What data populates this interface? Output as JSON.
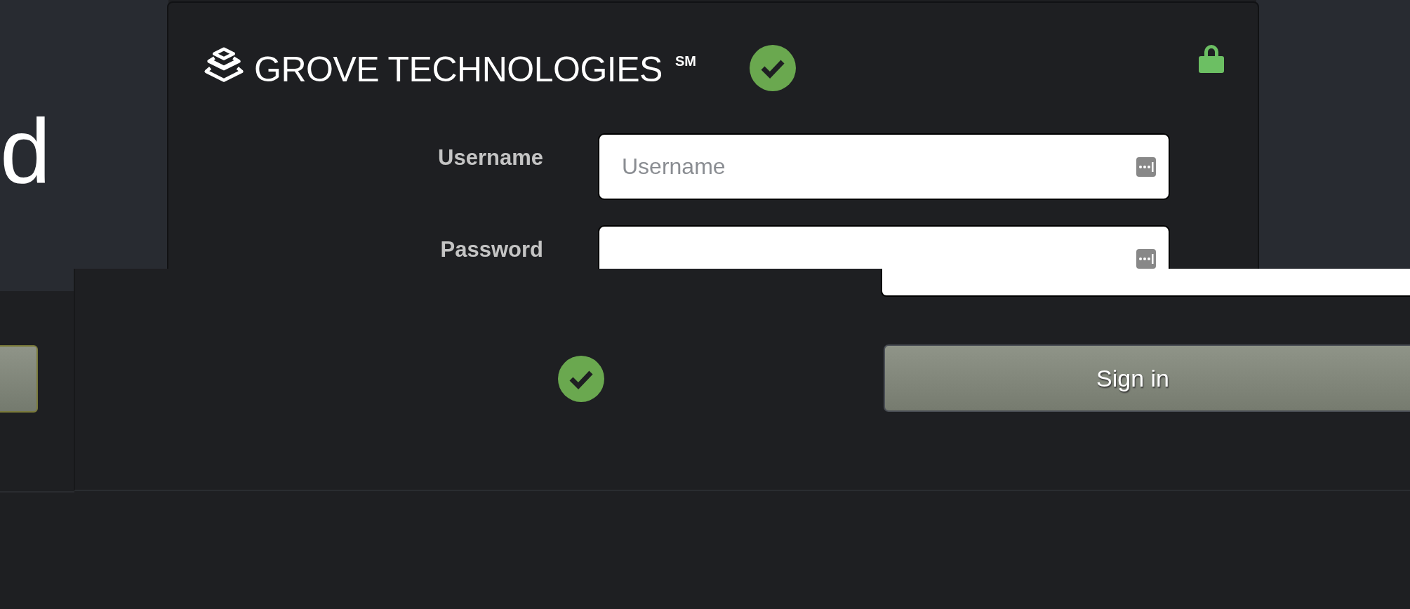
{
  "heading_fragment": "d",
  "brand": {
    "name": "GROVE TECHNOLOGIES",
    "mark": "SM",
    "verified": true
  },
  "secure": true,
  "fields": [
    {
      "label": "Username",
      "placeholder": "Username"
    },
    {
      "label": "Password"
    }
  ],
  "overlay": {
    "verified": true,
    "button": "Sign in"
  }
}
